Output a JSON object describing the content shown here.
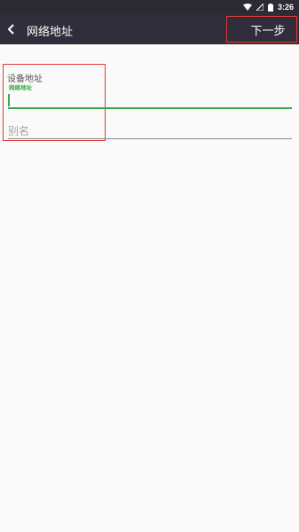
{
  "status_bar": {
    "time": "3:26",
    "icons": [
      "wifi-icon",
      "signal-icon",
      "battery-icon"
    ]
  },
  "toolbar": {
    "title": "网络地址",
    "next_label": "下一步",
    "back_icon": "chevron-left-icon"
  },
  "form": {
    "device_label": "设备地址",
    "device_hint": "网络地址",
    "device_value": "",
    "alias_placeholder": "别名",
    "alias_value": ""
  },
  "colors": {
    "toolbar_bg": "#2f2e3a",
    "accent": "#3aa84c",
    "highlight": "#e53935"
  }
}
